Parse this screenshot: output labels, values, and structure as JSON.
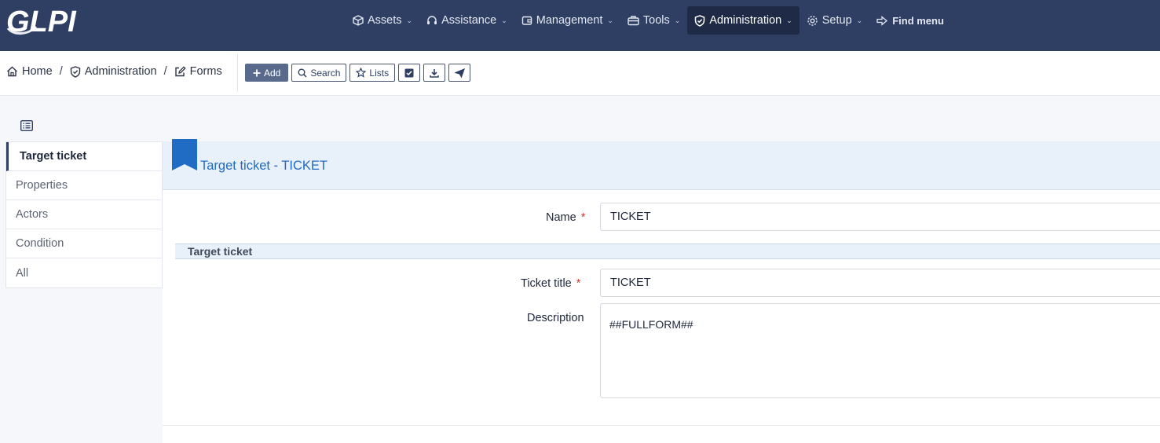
{
  "app": {
    "logo_text": "GLPI"
  },
  "nav": {
    "items": [
      {
        "label": "Assets",
        "icon": "cube-icon"
      },
      {
        "label": "Assistance",
        "icon": "headset-icon"
      },
      {
        "label": "Management",
        "icon": "wallet-icon"
      },
      {
        "label": "Tools",
        "icon": "briefcase-icon"
      },
      {
        "label": "Administration",
        "icon": "shield-icon",
        "active": true
      },
      {
        "label": "Setup",
        "icon": "gear-icon"
      }
    ],
    "find_menu": "Find menu"
  },
  "breadcrumb": {
    "home": "Home",
    "administration": "Administration",
    "forms": "Forms",
    "separator": "/"
  },
  "toolbar": {
    "add": "Add",
    "search": "Search",
    "lists": "Lists"
  },
  "tabs": [
    {
      "label": "Target ticket",
      "active": true
    },
    {
      "label": "Properties"
    },
    {
      "label": "Actors"
    },
    {
      "label": "Condition"
    },
    {
      "label": "All"
    }
  ],
  "panel": {
    "title": "Target ticket - TICKET",
    "name_label": "Name",
    "name_value": "TICKET",
    "section_title": "Target ticket",
    "ticket_title_label": "Ticket title",
    "ticket_title_value": "TICKET",
    "description_label": "Description",
    "description_value": "##FULLFORM##",
    "required_marker": "*"
  },
  "colors": {
    "navbar": "#2f3f64",
    "navbar_active": "#1f2a46",
    "accent": "#206bc4",
    "required": "#d63939"
  }
}
